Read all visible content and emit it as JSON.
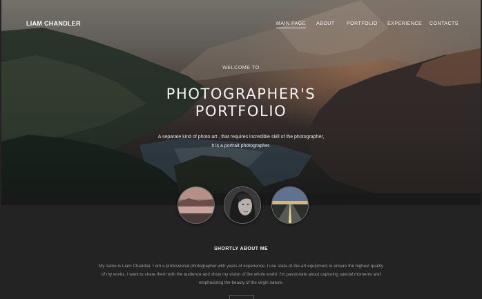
{
  "brand": "LIAM CHANDLER",
  "nav": {
    "items": [
      {
        "label": "MAIN PAGE",
        "active": true
      },
      {
        "label": "ABOUT",
        "active": false
      },
      {
        "label": "PORTFOLIO",
        "active": false
      },
      {
        "label": "EXPERIENCE",
        "active": false
      },
      {
        "label": "CONTACTS",
        "active": false
      }
    ]
  },
  "hero": {
    "welcome": "WELCOME TO",
    "title_line1": "PHOTOGRAPHER'S",
    "title_line2": "PORTFOLIO",
    "tagline_line1": "A separate kind of photo art , that requires incredible skill of the photographer,",
    "tagline_line2": "It is a portrait photographer."
  },
  "thumbnails": [
    {
      "name": "landscape-lake-thumbnail"
    },
    {
      "name": "portrait-woman-thumbnail"
    },
    {
      "name": "road-sunset-thumbnail"
    }
  ],
  "about": {
    "title": "SHORTLY ABOUT ME",
    "text_line1": "My name is Liam Chandler. I am a professional photographer with years of experience. I use state-of-the-art equipment to ensure the highest quality",
    "text_line2": "of my works. I want to share them with the audience and show my vision of the whole world. I'm passionate about capturing special moments and",
    "text_line3": "emphasizing the beauty of the virgin nature."
  },
  "colors": {
    "background": "#232323",
    "text": "#e9e9e9",
    "muted_text": "#9c9c9c",
    "sunset_glow": "#d68e5c"
  }
}
